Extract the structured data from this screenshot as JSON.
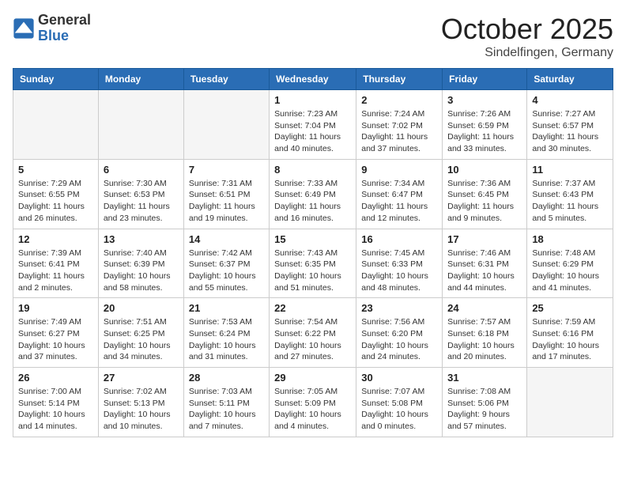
{
  "header": {
    "logo_general": "General",
    "logo_blue": "Blue",
    "month": "October 2025",
    "location": "Sindelfingen, Germany"
  },
  "weekdays": [
    "Sunday",
    "Monday",
    "Tuesday",
    "Wednesday",
    "Thursday",
    "Friday",
    "Saturday"
  ],
  "weeks": [
    [
      {
        "day": "",
        "info": ""
      },
      {
        "day": "",
        "info": ""
      },
      {
        "day": "",
        "info": ""
      },
      {
        "day": "1",
        "info": "Sunrise: 7:23 AM\nSunset: 7:04 PM\nDaylight: 11 hours and 40 minutes."
      },
      {
        "day": "2",
        "info": "Sunrise: 7:24 AM\nSunset: 7:02 PM\nDaylight: 11 hours and 37 minutes."
      },
      {
        "day": "3",
        "info": "Sunrise: 7:26 AM\nSunset: 6:59 PM\nDaylight: 11 hours and 33 minutes."
      },
      {
        "day": "4",
        "info": "Sunrise: 7:27 AM\nSunset: 6:57 PM\nDaylight: 11 hours and 30 minutes."
      }
    ],
    [
      {
        "day": "5",
        "info": "Sunrise: 7:29 AM\nSunset: 6:55 PM\nDaylight: 11 hours and 26 minutes."
      },
      {
        "day": "6",
        "info": "Sunrise: 7:30 AM\nSunset: 6:53 PM\nDaylight: 11 hours and 23 minutes."
      },
      {
        "day": "7",
        "info": "Sunrise: 7:31 AM\nSunset: 6:51 PM\nDaylight: 11 hours and 19 minutes."
      },
      {
        "day": "8",
        "info": "Sunrise: 7:33 AM\nSunset: 6:49 PM\nDaylight: 11 hours and 16 minutes."
      },
      {
        "day": "9",
        "info": "Sunrise: 7:34 AM\nSunset: 6:47 PM\nDaylight: 11 hours and 12 minutes."
      },
      {
        "day": "10",
        "info": "Sunrise: 7:36 AM\nSunset: 6:45 PM\nDaylight: 11 hours and 9 minutes."
      },
      {
        "day": "11",
        "info": "Sunrise: 7:37 AM\nSunset: 6:43 PM\nDaylight: 11 hours and 5 minutes."
      }
    ],
    [
      {
        "day": "12",
        "info": "Sunrise: 7:39 AM\nSunset: 6:41 PM\nDaylight: 11 hours and 2 minutes."
      },
      {
        "day": "13",
        "info": "Sunrise: 7:40 AM\nSunset: 6:39 PM\nDaylight: 10 hours and 58 minutes."
      },
      {
        "day": "14",
        "info": "Sunrise: 7:42 AM\nSunset: 6:37 PM\nDaylight: 10 hours and 55 minutes."
      },
      {
        "day": "15",
        "info": "Sunrise: 7:43 AM\nSunset: 6:35 PM\nDaylight: 10 hours and 51 minutes."
      },
      {
        "day": "16",
        "info": "Sunrise: 7:45 AM\nSunset: 6:33 PM\nDaylight: 10 hours and 48 minutes."
      },
      {
        "day": "17",
        "info": "Sunrise: 7:46 AM\nSunset: 6:31 PM\nDaylight: 10 hours and 44 minutes."
      },
      {
        "day": "18",
        "info": "Sunrise: 7:48 AM\nSunset: 6:29 PM\nDaylight: 10 hours and 41 minutes."
      }
    ],
    [
      {
        "day": "19",
        "info": "Sunrise: 7:49 AM\nSunset: 6:27 PM\nDaylight: 10 hours and 37 minutes."
      },
      {
        "day": "20",
        "info": "Sunrise: 7:51 AM\nSunset: 6:25 PM\nDaylight: 10 hours and 34 minutes."
      },
      {
        "day": "21",
        "info": "Sunrise: 7:53 AM\nSunset: 6:24 PM\nDaylight: 10 hours and 31 minutes."
      },
      {
        "day": "22",
        "info": "Sunrise: 7:54 AM\nSunset: 6:22 PM\nDaylight: 10 hours and 27 minutes."
      },
      {
        "day": "23",
        "info": "Sunrise: 7:56 AM\nSunset: 6:20 PM\nDaylight: 10 hours and 24 minutes."
      },
      {
        "day": "24",
        "info": "Sunrise: 7:57 AM\nSunset: 6:18 PM\nDaylight: 10 hours and 20 minutes."
      },
      {
        "day": "25",
        "info": "Sunrise: 7:59 AM\nSunset: 6:16 PM\nDaylight: 10 hours and 17 minutes."
      }
    ],
    [
      {
        "day": "26",
        "info": "Sunrise: 7:00 AM\nSunset: 5:14 PM\nDaylight: 10 hours and 14 minutes."
      },
      {
        "day": "27",
        "info": "Sunrise: 7:02 AM\nSunset: 5:13 PM\nDaylight: 10 hours and 10 minutes."
      },
      {
        "day": "28",
        "info": "Sunrise: 7:03 AM\nSunset: 5:11 PM\nDaylight: 10 hours and 7 minutes."
      },
      {
        "day": "29",
        "info": "Sunrise: 7:05 AM\nSunset: 5:09 PM\nDaylight: 10 hours and 4 minutes."
      },
      {
        "day": "30",
        "info": "Sunrise: 7:07 AM\nSunset: 5:08 PM\nDaylight: 10 hours and 0 minutes."
      },
      {
        "day": "31",
        "info": "Sunrise: 7:08 AM\nSunset: 5:06 PM\nDaylight: 9 hours and 57 minutes."
      },
      {
        "day": "",
        "info": ""
      }
    ]
  ]
}
